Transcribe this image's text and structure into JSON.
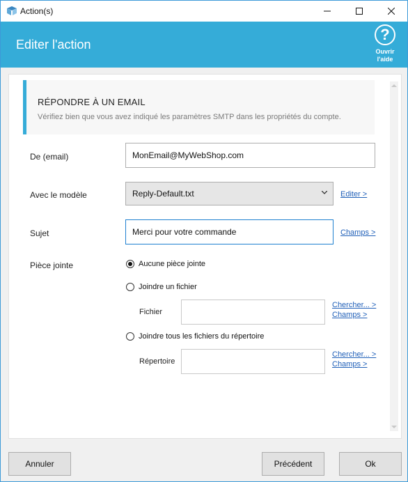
{
  "window": {
    "title": "Action(s)"
  },
  "header": {
    "title": "Editer l'action",
    "help_line1": "Ouvrir",
    "help_line2": "l'aide",
    "color": "#35acd8"
  },
  "section": {
    "title": "RÉPONDRE À UN EMAIL",
    "description": "Vérifiez bien que vous avez indiqué les paramètres SMTP dans les propriétés du compte."
  },
  "form": {
    "from_label": "De (email)",
    "from_value": "MonEmail@MyWebShop.com",
    "template_label": "Avec le modèle",
    "template_value": "Reply-Default.txt",
    "template_edit_link": "Editer >",
    "subject_label": "Sujet",
    "subject_value": "Merci pour votre commande",
    "subject_fields_link": "Champs >",
    "attachment_label": "Pièce jointe",
    "attachment_options": [
      {
        "label": "Aucune pièce jointe",
        "selected": true
      },
      {
        "label": "Joindre un fichier",
        "selected": false
      },
      {
        "label": "Joindre tous les fichiers du répertoire",
        "selected": false
      }
    ],
    "file_label": "Fichier",
    "file_value": "",
    "file_browse_link": "Chercher... >",
    "file_fields_link": "Champs >",
    "dir_label": "Répertoire",
    "dir_value": "",
    "dir_browse_link": "Chercher... >",
    "dir_fields_link": "Champs >"
  },
  "footer": {
    "cancel_label": "Annuler",
    "previous_label": "Précédent",
    "ok_label": "Ok"
  }
}
